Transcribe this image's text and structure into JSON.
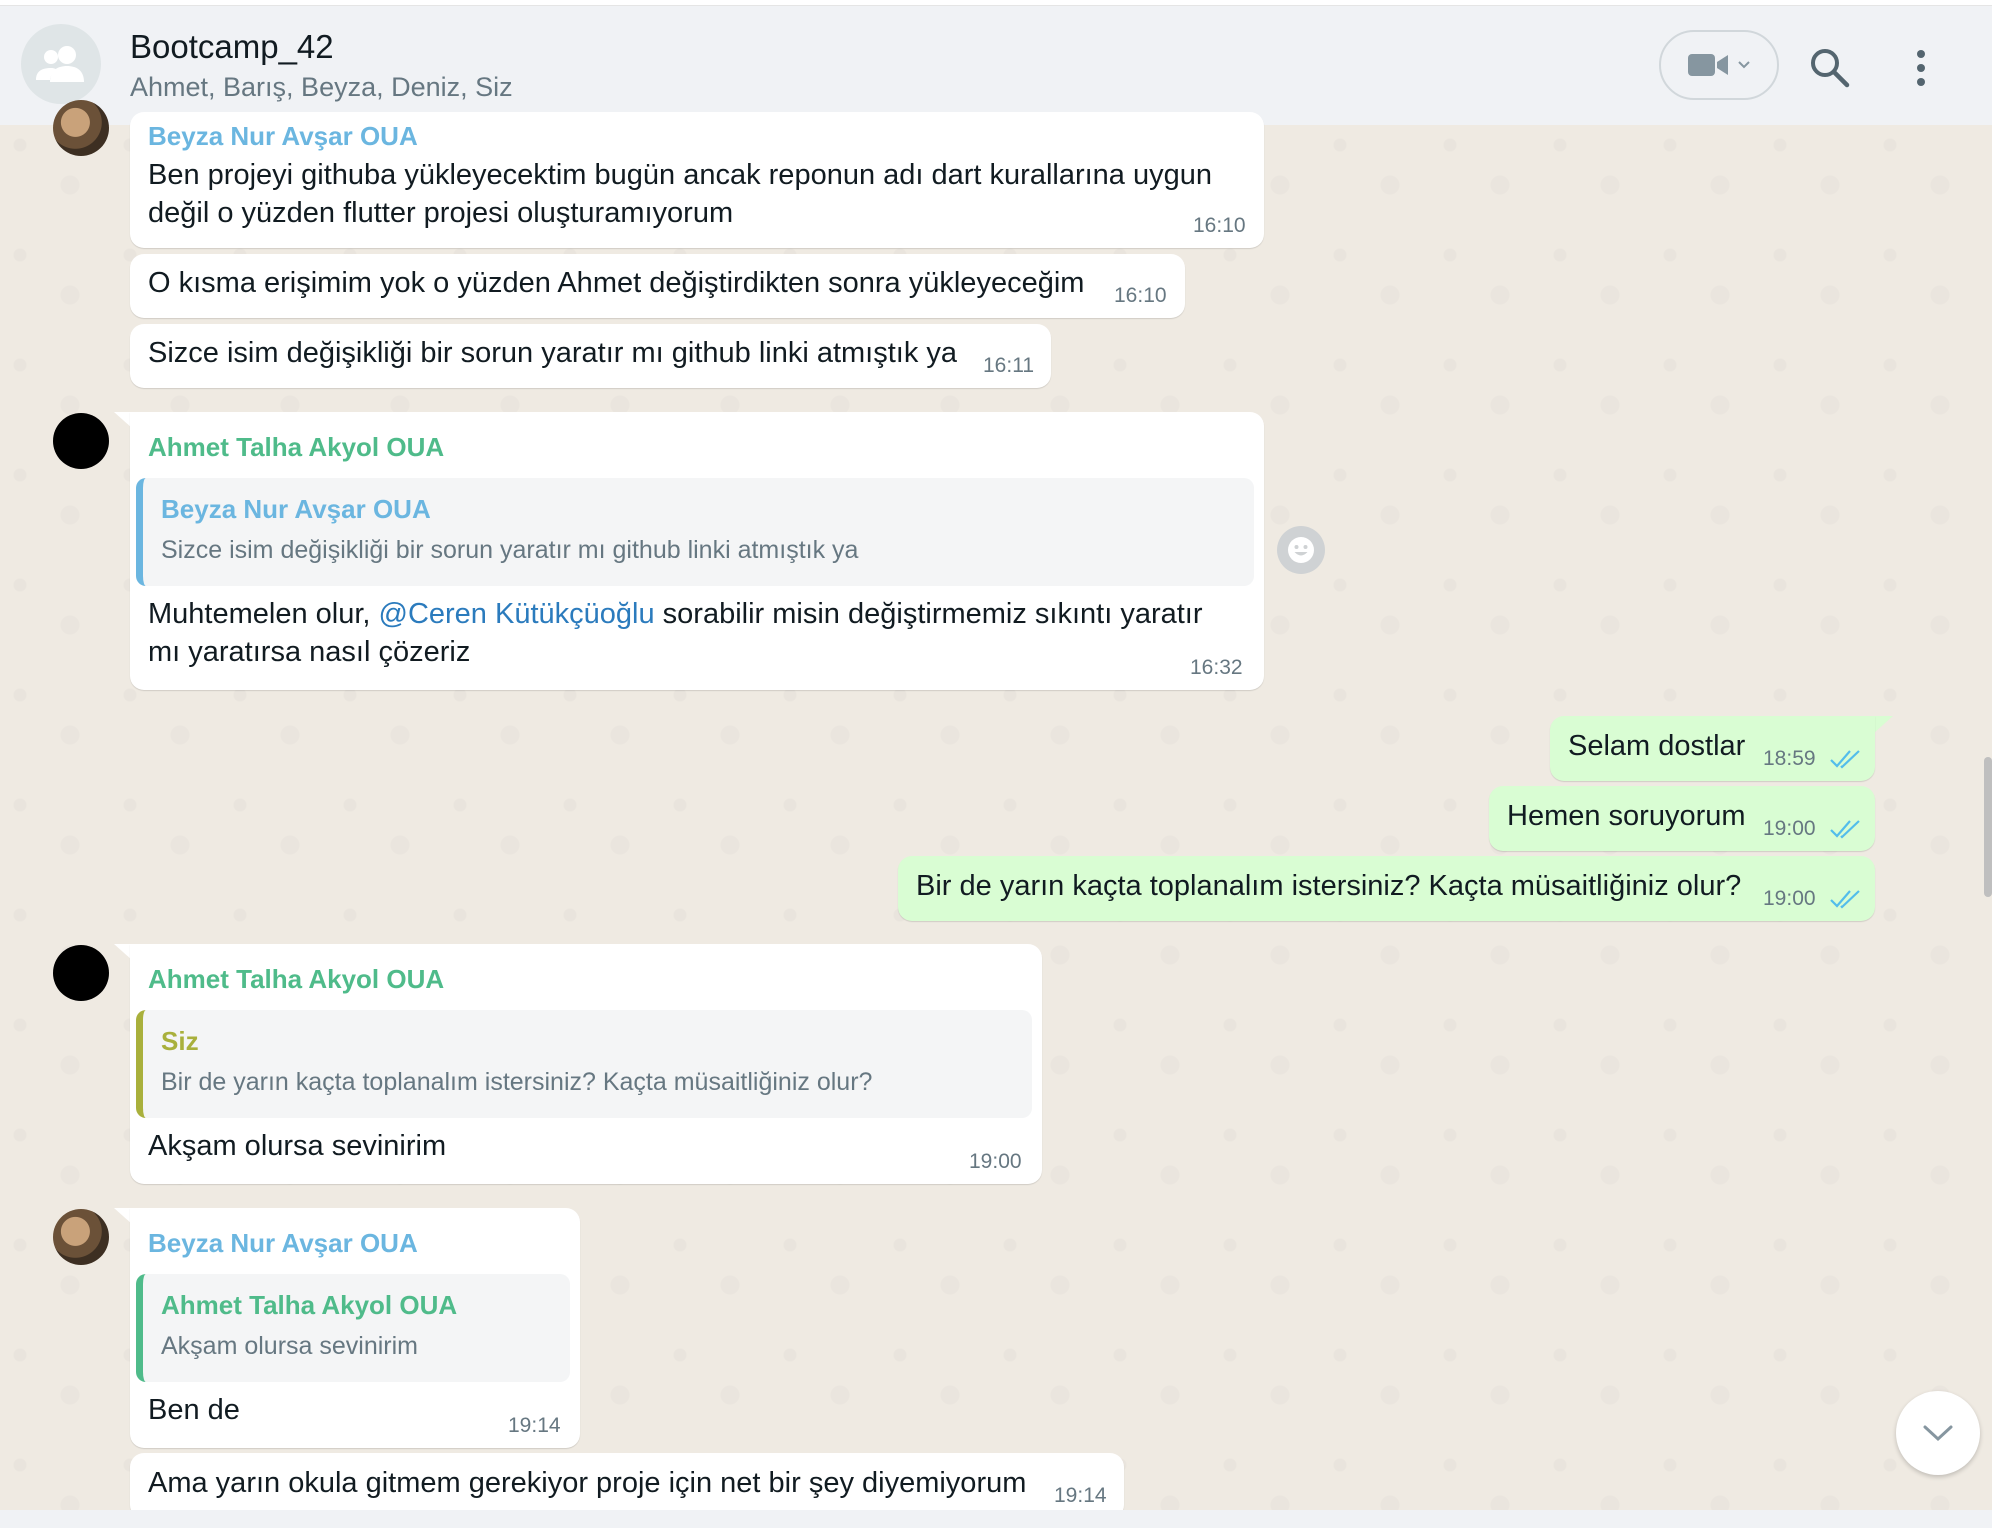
{
  "header": {
    "title": "Bootcamp_42",
    "members": "Ahmet, Barış, Beyza, Deniz, Siz",
    "icons": [
      "group-icon",
      "video-call-icon",
      "search-icon",
      "menu-icon"
    ]
  },
  "messages": [
    {
      "sender": "Beyza Nur Avşar OUA",
      "lines": [
        "Ben projeyi githuba yükleyecektim bugün ancak reponun adı dart kurallarına uygun",
        "değil o yüzden flutter projesi oluşturamıyorum"
      ],
      "time": "16:10"
    },
    {
      "text": "O kısma erişimim yok o yüzden Ahmet değiştirdikten sonra yükleyeceğim",
      "time": "16:10"
    },
    {
      "text": "Sizce isim değişikliği bir sorun yaratır mı github linki atmıştık ya",
      "time": "16:11"
    },
    {
      "sender": "Ahmet Talha Akyol OUA",
      "quote_name": "Beyza Nur Avşar OUA",
      "quote_text": "Sizce isim değişikliği bir sorun yaratır mı github linki atmıştık ya",
      "text_before": "Muhtemelen olur, ",
      "mention": "@Ceren Kütükçüoğlu",
      "text_after": " sorabilir misin değiştirmemiz sıkıntı yaratır",
      "line2": "mı yaratırsa nasıl çözeriz",
      "time": "16:32"
    },
    {
      "text": "Selam dostlar",
      "time": "18:59"
    },
    {
      "text": "Hemen soruyorum",
      "time": "19:00"
    },
    {
      "text": "Bir de yarın kaçta toplanalım istersiniz? Kaçta müsaitliğiniz olur?",
      "time": "19:00"
    },
    {
      "sender": "Ahmet Talha Akyol OUA",
      "quote_name": "Siz",
      "quote_text": "Bir de yarın kaçta toplanalım istersiniz? Kaçta müsaitliğiniz olur?",
      "text": "Akşam olursa sevinirim",
      "time": "19:00"
    },
    {
      "sender": "Beyza Nur Avşar OUA",
      "quote_name": "Ahmet Talha Akyol OUA",
      "quote_text": "Akşam olursa sevinirim",
      "text": "Ben de",
      "time": "19:14"
    },
    {
      "text": "Ama yarın okula gitmem gerekiyor proje için net bir şey diyemiyorum",
      "time": "19:14"
    }
  ],
  "colors": {
    "outgoing_bubble": "#d9fdd3",
    "incoming_bubble": "#ffffff",
    "sender_beyza": "#6bb6e0",
    "sender_ahmet": "#4fbb8a",
    "quote_self": "#a9b03c",
    "read_ticks": "#53bdeb"
  }
}
